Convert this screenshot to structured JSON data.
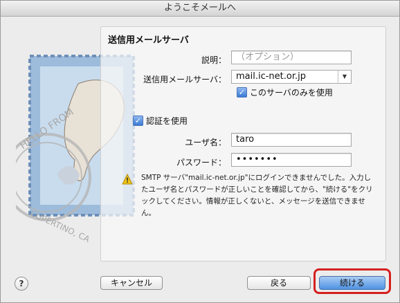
{
  "window": {
    "title": "ようこそメールへ"
  },
  "section": {
    "title": "送信用メールサーバ"
  },
  "form": {
    "description_label": "説明：",
    "description_placeholder": "（オプション）",
    "smtp_label": "送信用メールサーバ：",
    "smtp_value": "mail.ic-net.or.jp",
    "only_this_server_label": "このサーバのみを使用",
    "use_auth_label": "認証を使用",
    "username_label": "ユーザ名：",
    "username_value": "taro",
    "password_label": "パスワード：",
    "password_value": "•••••••"
  },
  "warning": {
    "text": "SMTP サーバ\"mail.ic-net.or.jp\"にログインできませんでした。入力したユーザ名とパスワードが正しいことを確認してから、\"続ける\"をクリックしてください。情報が正しくないと、メッセージを送信できません。"
  },
  "buttons": {
    "help": "?",
    "cancel": "キャンセル",
    "back": "戻る",
    "continue": "続ける"
  },
  "stamp": {
    "text_top": "HELLO FROM",
    "text_bottom": "CUPERTINO, CA"
  },
  "colors": {
    "highlight": "#d51f1f",
    "primary_button": "#4f92e3",
    "checkbox": "#3a7bd5",
    "warning": "#f0c419"
  }
}
